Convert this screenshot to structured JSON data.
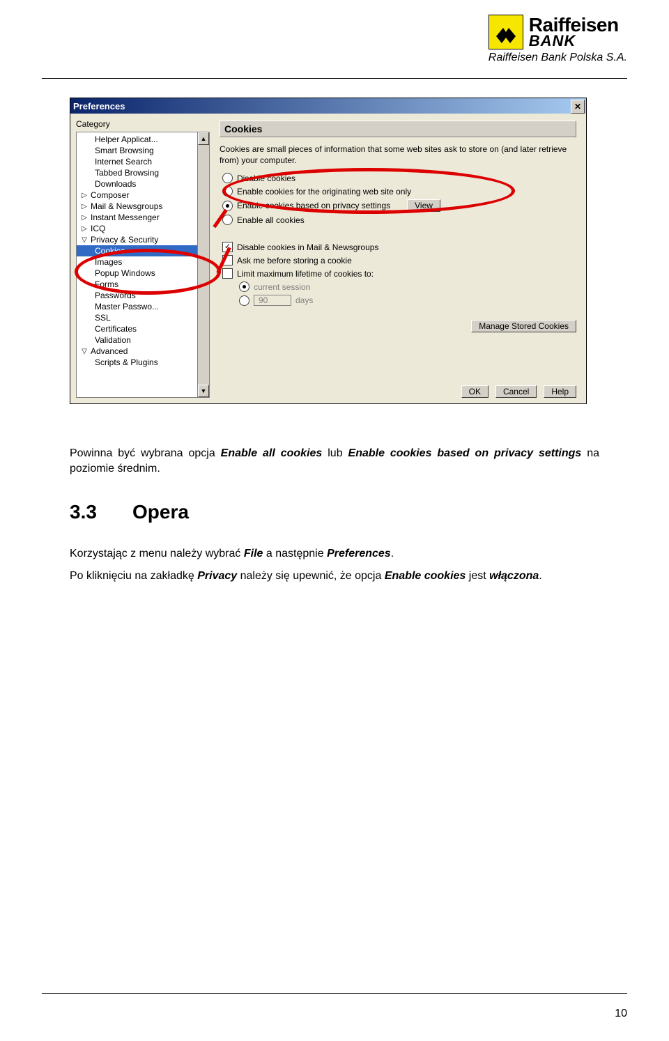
{
  "brand": {
    "name1": "Raiffeisen",
    "name2": "BANK",
    "sub": "Raiffeisen Bank Polska S.A."
  },
  "prefs": {
    "title": "Preferences",
    "close": "✕",
    "category_label": "Category",
    "tree": {
      "items": [
        {
          "level": 2,
          "label": "Helper Applicat..."
        },
        {
          "level": 2,
          "label": "Smart Browsing"
        },
        {
          "level": 2,
          "label": "Internet Search"
        },
        {
          "level": 2,
          "label": "Tabbed Browsing"
        },
        {
          "level": 2,
          "label": "Downloads"
        },
        {
          "level": 1,
          "twist": "▷",
          "label": "Composer"
        },
        {
          "level": 1,
          "twist": "▷",
          "label": "Mail & Newsgroups"
        },
        {
          "level": 1,
          "twist": "▷",
          "label": "Instant Messenger"
        },
        {
          "level": 1,
          "twist": "▷",
          "label": "ICQ"
        },
        {
          "level": 1,
          "twist": "▽",
          "label": "Privacy & Security"
        },
        {
          "level": 2,
          "label": "Cookies",
          "selected": true
        },
        {
          "level": 2,
          "label": "Images"
        },
        {
          "level": 2,
          "label": "Popup Windows"
        },
        {
          "level": 2,
          "label": "Forms"
        },
        {
          "level": 2,
          "label": "Passwords"
        },
        {
          "level": 2,
          "label": "Master Passwo..."
        },
        {
          "level": 2,
          "label": "SSL"
        },
        {
          "level": 2,
          "label": "Certificates"
        },
        {
          "level": 2,
          "label": "Validation"
        },
        {
          "level": 1,
          "twist": "▽",
          "label": "Advanced"
        },
        {
          "level": 2,
          "label": "Scripts & Plugins"
        }
      ],
      "scroll_up": "▲",
      "scroll_down": "▼"
    },
    "panel": {
      "title": "Cookies",
      "desc": "Cookies are small pieces of information that some web sites ask to store on (and later retrieve from) your computer.",
      "radios": [
        {
          "label": "Disable cookies",
          "selected": false
        },
        {
          "label": "Enable cookies for the originating web site only",
          "selected": false
        },
        {
          "label": "Enable cookies based on privacy settings",
          "selected": true,
          "view_btn": "View"
        },
        {
          "label": "Enable all cookies",
          "selected": false
        }
      ],
      "checks": [
        {
          "label": "Disable cookies in Mail & Newsgroups",
          "selected": true
        },
        {
          "label": "Ask me before storing a cookie",
          "selected": false
        },
        {
          "label": "Limit maximum lifetime of cookies to:",
          "selected": false
        }
      ],
      "limit": {
        "opt1": "current session",
        "opt_days_value": "90",
        "opt_days_label": "days"
      },
      "manage": "Manage Stored Cookies"
    },
    "buttons": {
      "ok": "OK",
      "cancel": "Cancel",
      "help": "Help"
    }
  },
  "body": {
    "para1_pre": "Powinna być wybrana opcja ",
    "para1_em1": "Enable all cookies",
    "para1_mid": " lub ",
    "para1_em2": "Enable cookies based on privacy settings",
    "para1_post": " na poziomie średnim.",
    "sec_num": "3.3",
    "sec_title": "Opera",
    "para2_pre": "Korzystając z menu należy wybrać ",
    "para2_em1": "File",
    "para2_mid": " a następnie ",
    "para2_em2": "Preferences",
    "para2_post": ".",
    "para3_pre": "Po kliknięciu na zakładkę ",
    "para3_em1": "Privacy",
    "para3_mid": " należy się upewnić, że opcja ",
    "para3_em2": "Enable cookies",
    "para3_post": " jest ",
    "para3_em3": "włączona",
    "para3_end": "."
  },
  "page_number": "10"
}
